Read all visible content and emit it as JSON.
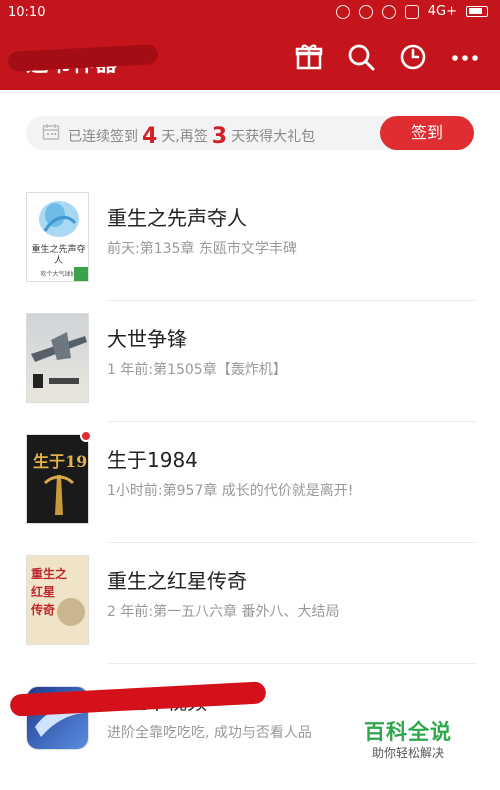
{
  "status_bar": {
    "time": "10:10",
    "network": "4G+"
  },
  "app_bar": {
    "title": "追书神器",
    "icons": [
      "gift-icon",
      "search-icon",
      "clock-icon",
      "more-icon"
    ]
  },
  "signin": {
    "text_before": "已连续签到",
    "days_signed": "4",
    "text_middle": "天,再签",
    "days_left": "3",
    "text_after": "天获得大礼包",
    "button": "签到"
  },
  "books": [
    {
      "title": "重生之先声夺人",
      "update": "前天:第135章 东瓯市文学丰碑",
      "cover_title": "重生之先声夺人",
      "cover_author": "吹个大气球好"
    },
    {
      "title": "大世争锋",
      "update": "1 年前:第1505章【轰炸机】"
    },
    {
      "title": "生于1984",
      "update": "1小时前:第957章 成长的代价就是离开!"
    },
    {
      "title": "重生之红星传奇",
      "update": "2 年前:第一五八六章 番外八、大结局"
    },
    {
      "title": "大主宰视频",
      "update": "进阶全靠吃吃吃, 成功与否看人品"
    }
  ],
  "watermark": {
    "title": "百科全说",
    "subtitle": "助你轻松解决"
  },
  "colors": {
    "brand_red": "#c4151c",
    "button_red": "#e02d32",
    "watermark_green": "#2fa84c"
  }
}
